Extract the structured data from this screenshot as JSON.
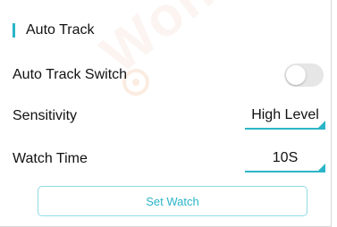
{
  "section": {
    "title": "Auto Track"
  },
  "rows": {
    "auto_track_switch": {
      "label": "Auto Track Switch",
      "on": false
    },
    "sensitivity": {
      "label": "Sensitivity",
      "value": "High Level"
    },
    "watch_time": {
      "label": "Watch Time",
      "value": "10S"
    }
  },
  "actions": {
    "set_watch_label": "Set Watch"
  },
  "watermark": {
    "text": "Wonsee"
  },
  "colors": {
    "accent": "#2bb5c8",
    "switch_off": "#e6e6e6",
    "button_border": "#8fdbe6"
  }
}
